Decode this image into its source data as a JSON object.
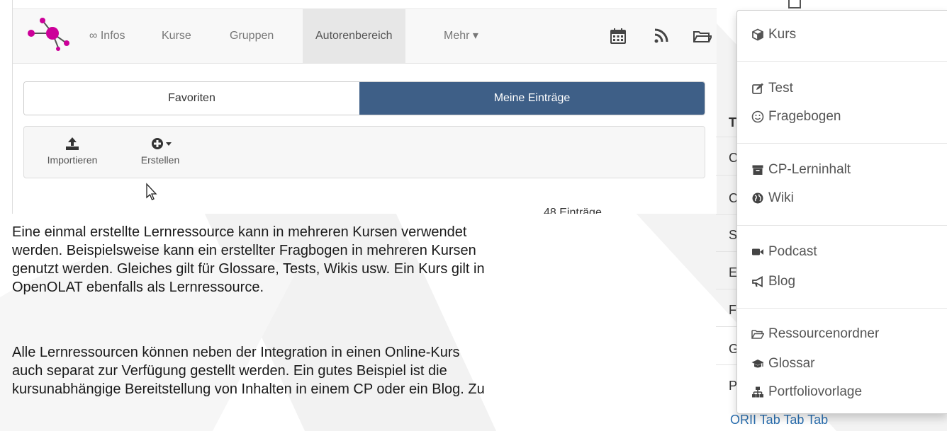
{
  "nav": {
    "items": [
      "∞ Infos",
      "Kurse",
      "Gruppen",
      "Autorenbereich",
      "Mehr ▾"
    ],
    "icons": [
      "calendar-icon",
      "rss-icon",
      "folder-icon"
    ]
  },
  "tabs": {
    "favorites": "Favoriten",
    "my_entries": "Meine Einträge"
  },
  "toolbar": {
    "import_label": "Importieren",
    "create_label": "Erstellen"
  },
  "entries_count": "48 Einträge",
  "paragraphs": {
    "p1_lines": [
      "Eine einmal erstellte Lernressource kann in mehreren Kursen verwendet",
      "werden. Beispielsweise kann ein erstellter Fragbogen in mehreren Kursen",
      "genutzt werden. Gleiches gilt für Glossare, Tests, Wikis usw. Ein Kurs gilt in",
      "OpenOLAT ebenfalls  als Lernressource."
    ],
    "p2_lines": [
      "Alle Lernressourcen können neben der Integration in einen Online-Kurs",
      "auch separat zur Verfügung gestellt werden. Ein gutes Beispiel ist die",
      "kursunabhängige Bereitstellung von Inhalten in einem CP oder ein Blog. Zu"
    ]
  },
  "background_table": {
    "header_letter": "T",
    "row_letters": [
      "C",
      "C",
      "S",
      "E",
      "F",
      "G",
      "P"
    ],
    "bottom_link": "ORII Tab Tab Tab"
  },
  "dropdown": {
    "groups": [
      [
        {
          "icon": "cube-icon",
          "label": "Kurs"
        }
      ],
      [
        {
          "icon": "edit-icon",
          "label": "Test"
        },
        {
          "icon": "smiley-icon",
          "label": "Fragebogen"
        }
      ],
      [
        {
          "icon": "archive-icon",
          "label": "CP-Lerninhalt"
        },
        {
          "icon": "globe-icon",
          "label": "Wiki"
        }
      ],
      [
        {
          "icon": "video-camera-icon",
          "label": "Podcast"
        },
        {
          "icon": "bullhorn-icon",
          "label": "Blog"
        }
      ],
      [
        {
          "icon": "folder-open-icon",
          "label": "Ressourcenordner"
        },
        {
          "icon": "graduation-cap-icon",
          "label": "Glossar"
        },
        {
          "icon": "sitemap-icon",
          "label": "Portfoliovorlage"
        }
      ]
    ]
  },
  "colors": {
    "logo_magenta": "#cc0099",
    "active_tab": "#3e5f87",
    "link_blue": "#2a6fb0"
  }
}
